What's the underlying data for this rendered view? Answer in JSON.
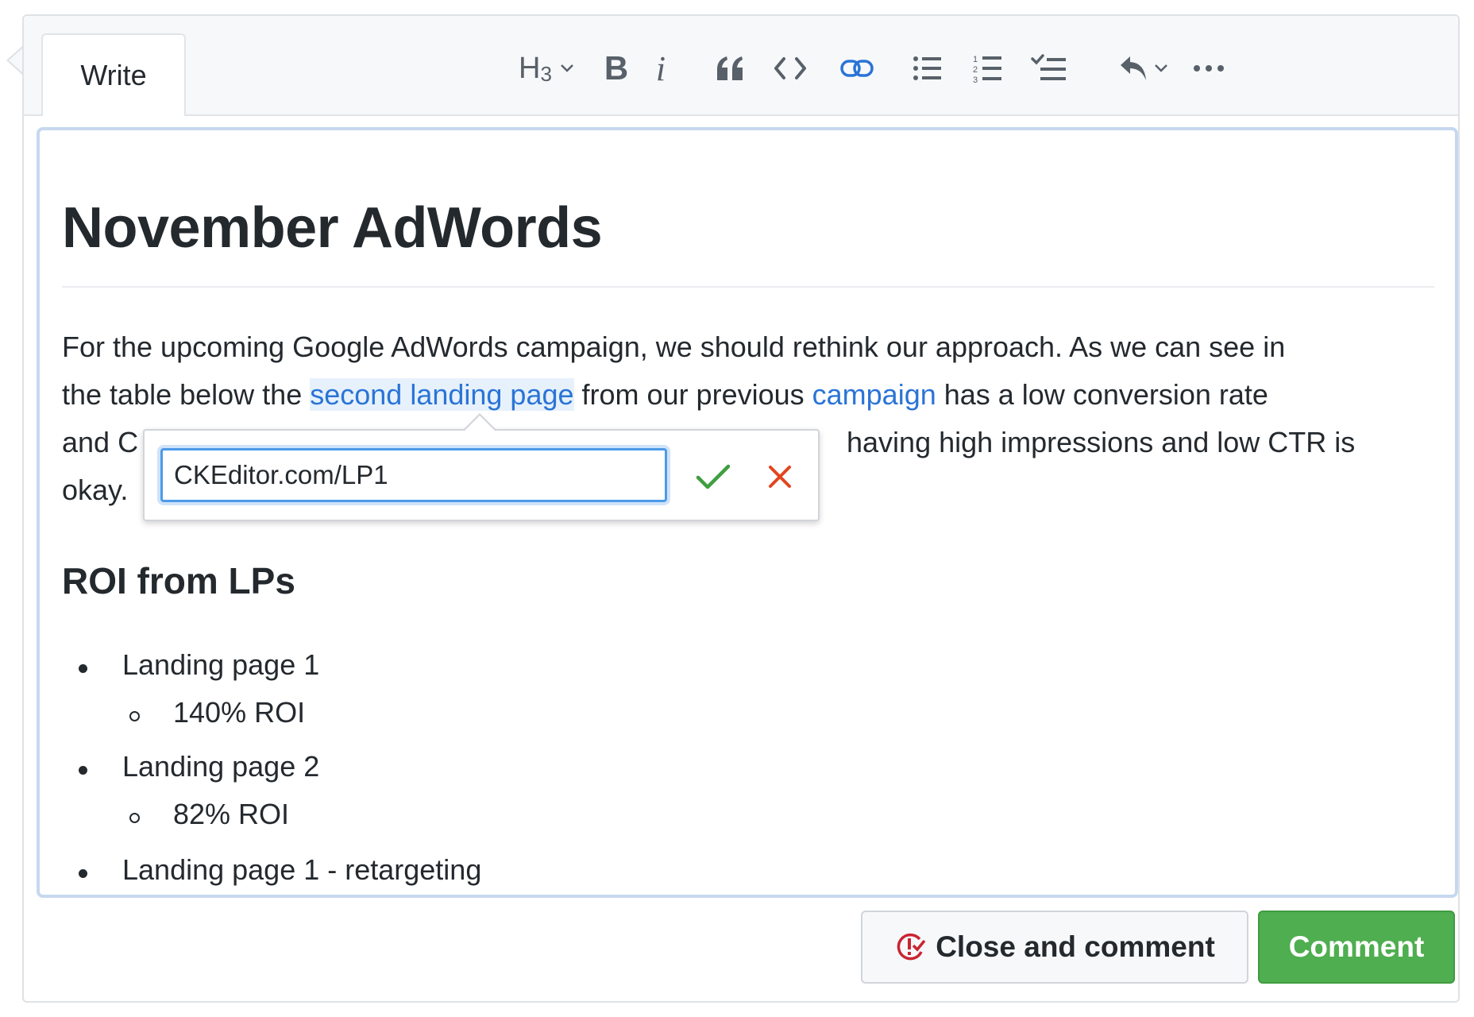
{
  "tabs": {
    "write_label": "Write"
  },
  "toolbar": {
    "heading_label": "H",
    "heading_sub": "3",
    "bold_label": "B",
    "italic_label": "i",
    "icons": [
      "heading-dropdown",
      "bold-icon",
      "italic-icon",
      "blockquote-icon",
      "code-icon",
      "link-icon",
      "bulleted-list-icon",
      "numbered-list-icon",
      "todo-list-icon",
      "undo-icon",
      "more-icon"
    ]
  },
  "document": {
    "title": "November AdWords",
    "paragraph": {
      "line1": "For the upcoming Google AdWords campaign, we should rethink our approach. As we can see in",
      "line2_a": "the table below the ",
      "line2_link1": "second landing page",
      "line2_b": " from our previous ",
      "line2_link2": "campaign",
      "line2_c": " has a low conversion rate",
      "line3_a": "and C",
      "line3_b": "having high impressions and low CTR is",
      "line4": "okay."
    },
    "subheading": "ROI from LPs",
    "list": [
      {
        "label": "Landing page 1",
        "sub": "140% ROI"
      },
      {
        "label": "Landing page 2",
        "sub": "82% ROI"
      },
      {
        "label": "Landing page 1 - retargeting"
      }
    ]
  },
  "link_balloon": {
    "url_value": "CKEditor.com/LP1"
  },
  "actions": {
    "close_label": "Close and comment",
    "comment_label": "Comment"
  },
  "colors": {
    "link": "#2a74d6",
    "save": "#3f9f3f",
    "cancel": "#e2461f",
    "comment_button": "#4fae4f"
  }
}
